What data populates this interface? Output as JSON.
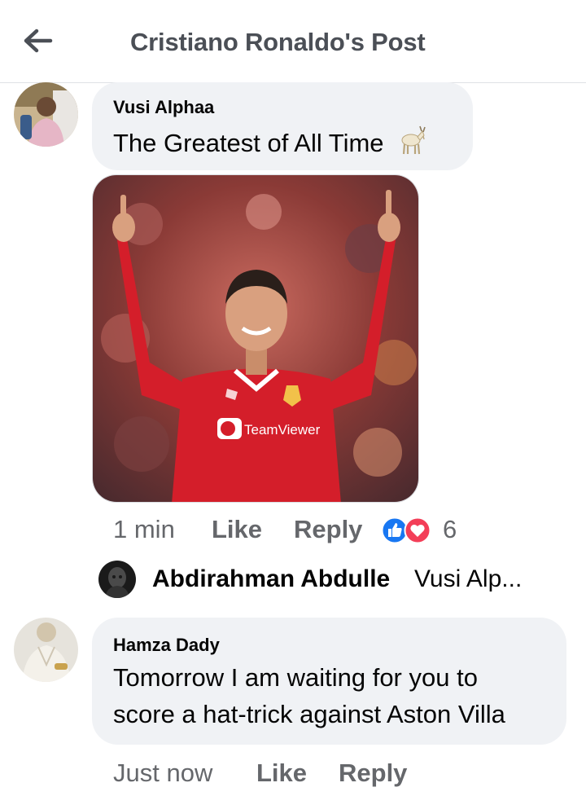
{
  "header": {
    "title": "Cristiano Ronaldo's Post",
    "back_icon": "arrow-left-icon"
  },
  "comments": [
    {
      "author": "Vusi Alphaa",
      "text": "The Greatest of All Time",
      "emoji": "🐐",
      "time": "1 min",
      "like_label": "Like",
      "reply_label": "Reply",
      "reaction_icons": [
        "like-icon",
        "love-icon"
      ],
      "reaction_count": "6",
      "reply_preview": {
        "author": "Abdirahman Abdulle",
        "snippet": "Vusi Alp..."
      }
    },
    {
      "author": "Hamza Dady",
      "text_line1": "Tomorrow I am waiting for you to",
      "text_line2": "score a hat-trick against Aston Villa",
      "time": "Just now",
      "like_label": "Like",
      "reply_label": "Reply"
    }
  ],
  "colors": {
    "like_blue": "#1877f2",
    "love_red": "#f33e58",
    "bubble": "#f0f2f5",
    "muted": "#65676b"
  }
}
